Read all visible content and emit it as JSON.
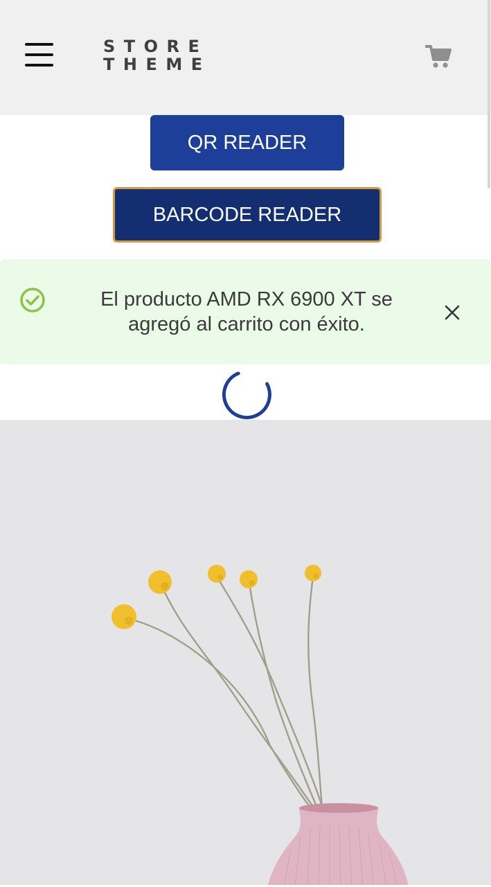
{
  "header": {
    "logo_line1": "STORE",
    "logo_line2": "THEME",
    "menu_icon": "hamburger-menu-icon",
    "cart_icon": "shopping-cart-icon"
  },
  "buttons": {
    "qr_label": "QR READER",
    "barcode_label": "BARCODE READER"
  },
  "alert": {
    "icon": "check-circle-icon",
    "message": "El producto AMD RX 6900 XT se agregó al carrito con éxito.",
    "close_icon": "close-icon"
  },
  "loading": {
    "icon": "loading-spinner-icon"
  },
  "colors": {
    "header_bg": "#f0f0f0",
    "primary": "#1e3f99",
    "primary_dark": "#142e72",
    "focus_border": "#d59a3c",
    "success_bg": "#eafbe7",
    "success_icon": "#8bc34a",
    "hero_bg": "#e5e5e7"
  }
}
